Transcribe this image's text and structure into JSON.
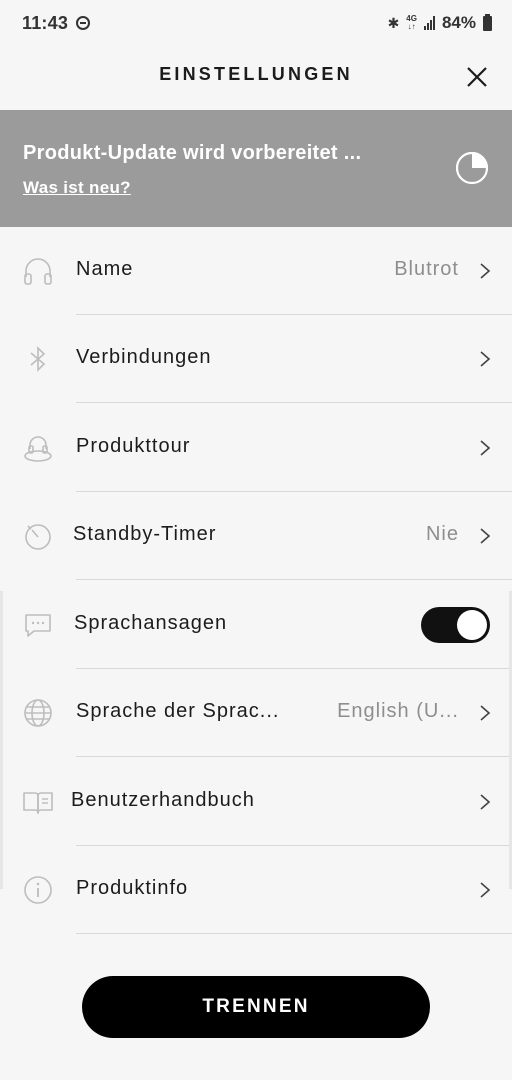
{
  "status_bar": {
    "time": "11:43",
    "network": "4G",
    "battery": "84%"
  },
  "header": {
    "title": "EINSTELLUNGEN",
    "close_icon": "close-icon"
  },
  "banner": {
    "title": "Produkt-Update wird vorbereitet ...",
    "link": "Was ist neu?",
    "progress": 0.25,
    "background_color": "#9b9b9b"
  },
  "settings": {
    "items": [
      {
        "label": "Name",
        "value": "Blutrot",
        "icon": "headphones-icon",
        "control": "chevron"
      },
      {
        "label": "Verbindungen",
        "value": "",
        "icon": "bluetooth-icon",
        "control": "chevron"
      },
      {
        "label": "Produkttour",
        "value": "",
        "icon": "product-tour-icon",
        "control": "chevron"
      },
      {
        "label": "Standby-Timer",
        "value": "Nie",
        "icon": "timer-icon",
        "control": "chevron"
      },
      {
        "label": "Sprachansagen",
        "value": "",
        "icon": "speech-bubble-icon",
        "control": "toggle",
        "toggle_on": true
      },
      {
        "label": "Sprache der Sprac...",
        "value": "English (U...",
        "icon": "globe-icon",
        "control": "chevron"
      },
      {
        "label": "Benutzerhandbuch",
        "value": "",
        "icon": "book-icon",
        "control": "chevron"
      },
      {
        "label": "Produktinfo",
        "value": "",
        "icon": "info-icon",
        "control": "chevron"
      }
    ]
  },
  "footer": {
    "disconnect_label": "TRENNEN"
  }
}
